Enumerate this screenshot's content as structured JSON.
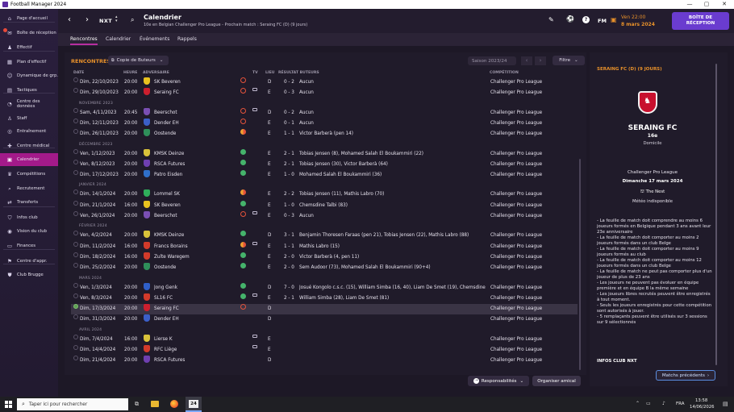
{
  "window": {
    "title": "Football Manager 2024",
    "min": "—",
    "max": "▢",
    "close": "✕"
  },
  "sidebar": [
    {
      "label": "Page d'accueil",
      "icon": "home-icon",
      "g": "⌂"
    },
    {
      "label": "Boîte de réception",
      "icon": "inbox-icon",
      "g": "✉"
    },
    {
      "label": "Effectif",
      "icon": "squad-icon",
      "g": "♟"
    },
    {
      "label": "Plan d'effectif",
      "icon": "squad-plan-icon",
      "g": "▦"
    },
    {
      "label": "Dynamique de grp.",
      "icon": "dynamics-icon",
      "g": "☺"
    },
    {
      "label": "Tactiques",
      "icon": "tactics-icon",
      "g": "▤"
    },
    {
      "label": "Centre des données",
      "icon": "data-icon",
      "g": "◔"
    },
    {
      "label": "Staff",
      "icon": "staff-icon",
      "g": "♙"
    },
    {
      "label": "Entraînement",
      "icon": "training-icon",
      "g": "◎"
    },
    {
      "label": "Centre médical",
      "icon": "medical-icon",
      "g": "✚"
    },
    {
      "label": "Calendrier",
      "icon": "calendar-icon",
      "g": "▣"
    },
    {
      "label": "Compétitions",
      "icon": "trophy-icon",
      "g": "♛"
    },
    {
      "label": "Recrutement",
      "icon": "scouting-icon",
      "g": "⌕"
    },
    {
      "label": "Transferts",
      "icon": "transfers-icon",
      "g": "⇄"
    },
    {
      "label": "Infos club",
      "icon": "club-info-icon",
      "g": "⛉"
    },
    {
      "label": "Vision du club",
      "icon": "club-vision-icon",
      "g": "◉"
    },
    {
      "label": "Finances",
      "icon": "finances-icon",
      "g": "▭"
    },
    {
      "label": "Centre d'appr.",
      "icon": "academy-icon",
      "g": "⚑"
    },
    {
      "label": "Club Brugge",
      "icon": "club-brugge-icon",
      "g": "⛊"
    }
  ],
  "topbar": {
    "title": "Calendrier",
    "subtitle": "10e en Belgian Challenger Pro League - Prochain match : Seraing FC (D) (9 jours)",
    "nxt": "NXT",
    "fm": "FM",
    "date_day": "Ven 22:00",
    "date": "8 mars 2024",
    "continue_label": "BOÎTE DE\nRÉCEPTION"
  },
  "tabs": [
    "Rencontres",
    "Calendrier",
    "Événements",
    "Rappels"
  ],
  "panel": {
    "title": "RENCONTRES",
    "dropdown": "Copie de Buteurs",
    "season": "Saison 2023/24",
    "filter": "Filtre",
    "cols": {
      "date": "DATE",
      "time": "HEURE",
      "opp": "ADVERSAIRE",
      "tv": "TV",
      "venue": "LIEU",
      "res": "RÉSULTAT BUTEURS",
      "comp": "COMPÉTITION"
    }
  },
  "fixtures": [
    {
      "t": "m",
      "date": "Dim, 22/10/2023",
      "time": "20:00",
      "opp": "SK Beveren",
      "c": "#e8c21f",
      "dot": "ring",
      "tv": false,
      "venue": "D",
      "res": "0 - 2",
      "sc": "Aucun",
      "comp": "Challenger Pro League"
    },
    {
      "t": "m",
      "date": "Dim, 29/10/2023",
      "time": "20:00",
      "opp": "Seraing FC",
      "c": "#cc1f2e",
      "dot": "ring",
      "tv": true,
      "venue": "E",
      "res": "0 - 3",
      "sc": "Aucun",
      "comp": "Challenger Pro League"
    },
    {
      "t": "h",
      "label": "NOVEMBRE 2023"
    },
    {
      "t": "m",
      "date": "Sam, 4/11/2023",
      "time": "20:45",
      "opp": "Beerschot",
      "c": "#7a4fb3",
      "dot": "ring",
      "tv": true,
      "venue": "D",
      "res": "0 - 2",
      "sc": "Aucun",
      "comp": "Challenger Pro League"
    },
    {
      "t": "m",
      "date": "Dim, 12/11/2023",
      "time": "20:00",
      "opp": "Dender EH",
      "c": "#3b5fc8",
      "dot": "ring",
      "tv": false,
      "venue": "E",
      "res": "0 - 1",
      "sc": "Aucun",
      "comp": "Challenger Pro League"
    },
    {
      "t": "m",
      "date": "Dim, 26/11/2023",
      "time": "20:00",
      "opp": "Oostende",
      "c": "#2f8f5a",
      "dot": "half",
      "tv": false,
      "venue": "E",
      "res": "1 - 1",
      "sc": "Victor Barberà (pen 14)",
      "comp": "Challenger Pro League"
    },
    {
      "t": "h",
      "label": "DÉCEMBRE 2023"
    },
    {
      "t": "m",
      "date": "Ven, 1/12/2023",
      "time": "20:00",
      "opp": "KMSK Deinze",
      "c": "#d9c23a",
      "dot": "grn",
      "tv": false,
      "venue": "E",
      "res": "2 - 1",
      "sc": "Tobias Jensen (8), Mohamed Salah El Boukammiri (22)",
      "comp": "Challenger Pro League"
    },
    {
      "t": "m",
      "date": "Ven, 8/12/2023",
      "time": "20:00",
      "opp": "RSCA Futures",
      "c": "#6f3fb0",
      "dot": "grn",
      "tv": false,
      "venue": "E",
      "res": "2 - 1",
      "sc": "Tobias Jensen (30), Victor Barberà (64)",
      "comp": "Challenger Pro League"
    },
    {
      "t": "m",
      "date": "Dim, 17/12/2023",
      "time": "20:00",
      "opp": "Patro Eisden",
      "c": "#2f6fc9",
      "dot": "grn",
      "tv": false,
      "venue": "E",
      "res": "1 - 0",
      "sc": "Mohamed Salah El Boukammiri (36)",
      "comp": "Challenger Pro League"
    },
    {
      "t": "h",
      "label": "JANVIER 2024"
    },
    {
      "t": "m",
      "date": "Dim, 14/1/2024",
      "time": "20:00",
      "opp": "Lommel SK",
      "c": "#2fae5b",
      "dot": "half",
      "tv": false,
      "venue": "E",
      "res": "2 - 2",
      "sc": "Tobias Jensen (11), Mathis Labro (70)",
      "comp": "Challenger Pro League"
    },
    {
      "t": "m",
      "date": "Dim, 21/1/2024",
      "time": "16:00",
      "opp": "SK Beveren",
      "c": "#e8c21f",
      "dot": "grn",
      "tv": false,
      "venue": "E",
      "res": "1 - 0",
      "sc": "Chemsdine Talbi (83)",
      "comp": "Challenger Pro League"
    },
    {
      "t": "m",
      "date": "Ven, 26/1/2024",
      "time": "20:00",
      "opp": "Beerschot",
      "c": "#7a4fb3",
      "dot": "ring",
      "tv": true,
      "venue": "E",
      "res": "0 - 3",
      "sc": "Aucun",
      "comp": "Challenger Pro League"
    },
    {
      "t": "h",
      "label": "FÉVRIER 2024"
    },
    {
      "t": "m",
      "date": "Ven, 4/2/2024",
      "time": "20:00",
      "opp": "KMSK Deinze",
      "c": "#d9c23a",
      "dot": "grn",
      "tv": false,
      "venue": "D",
      "res": "3 - 1",
      "sc": "Benjamin Thoresen Faraas (pen 21), Tobias Jensen (22), Mathis Labro (88)",
      "comp": "Challenger Pro League"
    },
    {
      "t": "m",
      "date": "Dim, 11/2/2024",
      "time": "16:00",
      "opp": "Francs Borains",
      "c": "#d23a2a",
      "dot": "half",
      "tv": true,
      "venue": "E",
      "res": "1 - 1",
      "sc": "Mathis Labro (15)",
      "comp": "Challenger Pro League"
    },
    {
      "t": "m",
      "date": "Dim, 18/2/2024",
      "time": "16:00",
      "opp": "Zulte Waregem",
      "c": "#d23a2a",
      "dot": "grn",
      "tv": false,
      "venue": "E",
      "res": "2 - 0",
      "sc": "Victor Barberà (4, pen 11)",
      "comp": "Challenger Pro League"
    },
    {
      "t": "m",
      "date": "Dim, 25/2/2024",
      "time": "20:00",
      "opp": "Oostende",
      "c": "#2f8f5a",
      "dot": "grn",
      "tv": false,
      "venue": "E",
      "res": "2 - 0",
      "sc": "Sem Audoor (73), Mohamed Salah El Boukammiri (90+4)",
      "comp": "Challenger Pro League"
    },
    {
      "t": "h",
      "label": "MARS 2024"
    },
    {
      "t": "m",
      "date": "Ven, 1/3/2024",
      "time": "20:00",
      "opp": "Jong Genk",
      "c": "#2f5fc8",
      "dot": "grn",
      "tv": false,
      "venue": "D",
      "res": "7 - 0",
      "sc": "Josué Kongolo c.s.c. (15), William Simba (16, 40), Liam De Smet (19), Chemsdine Talbi (25)",
      "comp": "Challenger Pro League"
    },
    {
      "t": "m",
      "date": "Ven, 8/3/2024",
      "time": "20:00",
      "opp": "SL16 FC",
      "c": "#d23a2a",
      "dot": "grn",
      "tv": true,
      "venue": "E",
      "res": "2 - 1",
      "sc": "William Simba (28), Liam De Smet (81)",
      "comp": "Challenger Pro League"
    },
    {
      "t": "m",
      "date": "Dim, 17/3/2024",
      "time": "20:00",
      "opp": "Seraing FC",
      "c": "#cc1f2e",
      "dot": "ring",
      "tv": false,
      "venue": "D",
      "res": "",
      "sc": "",
      "comp": "Challenger Pro League",
      "sel": true
    },
    {
      "t": "m",
      "date": "Dim, 31/3/2024",
      "time": "20:00",
      "opp": "Dender EH",
      "c": "#3b5fc8",
      "dot": "",
      "tv": false,
      "venue": "D",
      "res": "",
      "sc": "",
      "comp": "Challenger Pro League"
    },
    {
      "t": "h",
      "label": "AVRIL 2024"
    },
    {
      "t": "m",
      "date": "Dim, 7/4/2024",
      "time": "16:00",
      "opp": "Lierse K",
      "c": "#d9c23a",
      "dot": "",
      "tv": true,
      "venue": "E",
      "res": "",
      "sc": "",
      "comp": "Challenger Pro League"
    },
    {
      "t": "m",
      "date": "Dim, 14/4/2024",
      "time": "20:00",
      "opp": "RFC Liège",
      "c": "#d23a2a",
      "dot": "",
      "tv": true,
      "venue": "E",
      "res": "",
      "sc": "",
      "comp": "Challenger Pro League"
    },
    {
      "t": "m",
      "date": "Dim, 21/4/2024",
      "time": "20:00",
      "opp": "RSCA Futures",
      "c": "#6f3fb0",
      "dot": "",
      "tv": false,
      "venue": "D",
      "res": "",
      "sc": "",
      "comp": "Challenger Pro League"
    }
  ],
  "bottom": {
    "resp": "Responsabilités",
    "friendly": "Organiser amical"
  },
  "right": {
    "header": "SERAING FC (D) (9 JOURS)",
    "team": "SERAING FC",
    "pos": "16e",
    "venue": "Domicile",
    "comp": "Challenger Pro League",
    "date": "Dimanche 17 mars 2024",
    "stadium": "The Nest",
    "weather": "Météo indisponible",
    "rules": [
      "- La feuille de match doit comprendre au moins 6 joueurs formés en Belgique pendant 3 ans avant leur 23e anniversaire",
      "- La feuille de match doit comporter au moins 2 joueurs formés dans un club Belge",
      "- La feuille de match doit comporter au moins 9 joueurs formés au club",
      "- La feuille de match doit comporter au moins 12 joueurs formés dans un club Belge",
      "- La feuille de match ne peut pas comporter plus d'un joueur de plus de 23 ans",
      "- Les joueurs ne peuvent pas évoluer en équipe première et en équipe B la même semaine",
      "- Les joueurs libres recrutés peuvent être enregistrés à tout moment.",
      "- Seuls les joueurs enregistrés pour cette compétition sont autorisés à jouer.",
      "- 5 remplaçants peuvent être utilisés sur 3 sessions sur 9 sélectionnés"
    ],
    "info": "INFOS CLUB NXT",
    "prev": "Matchs précédents"
  },
  "taskbar": {
    "search": "Taper ici pour rechercher",
    "lang": "FRA",
    "time": "13:58",
    "date": "14/06/2026"
  }
}
